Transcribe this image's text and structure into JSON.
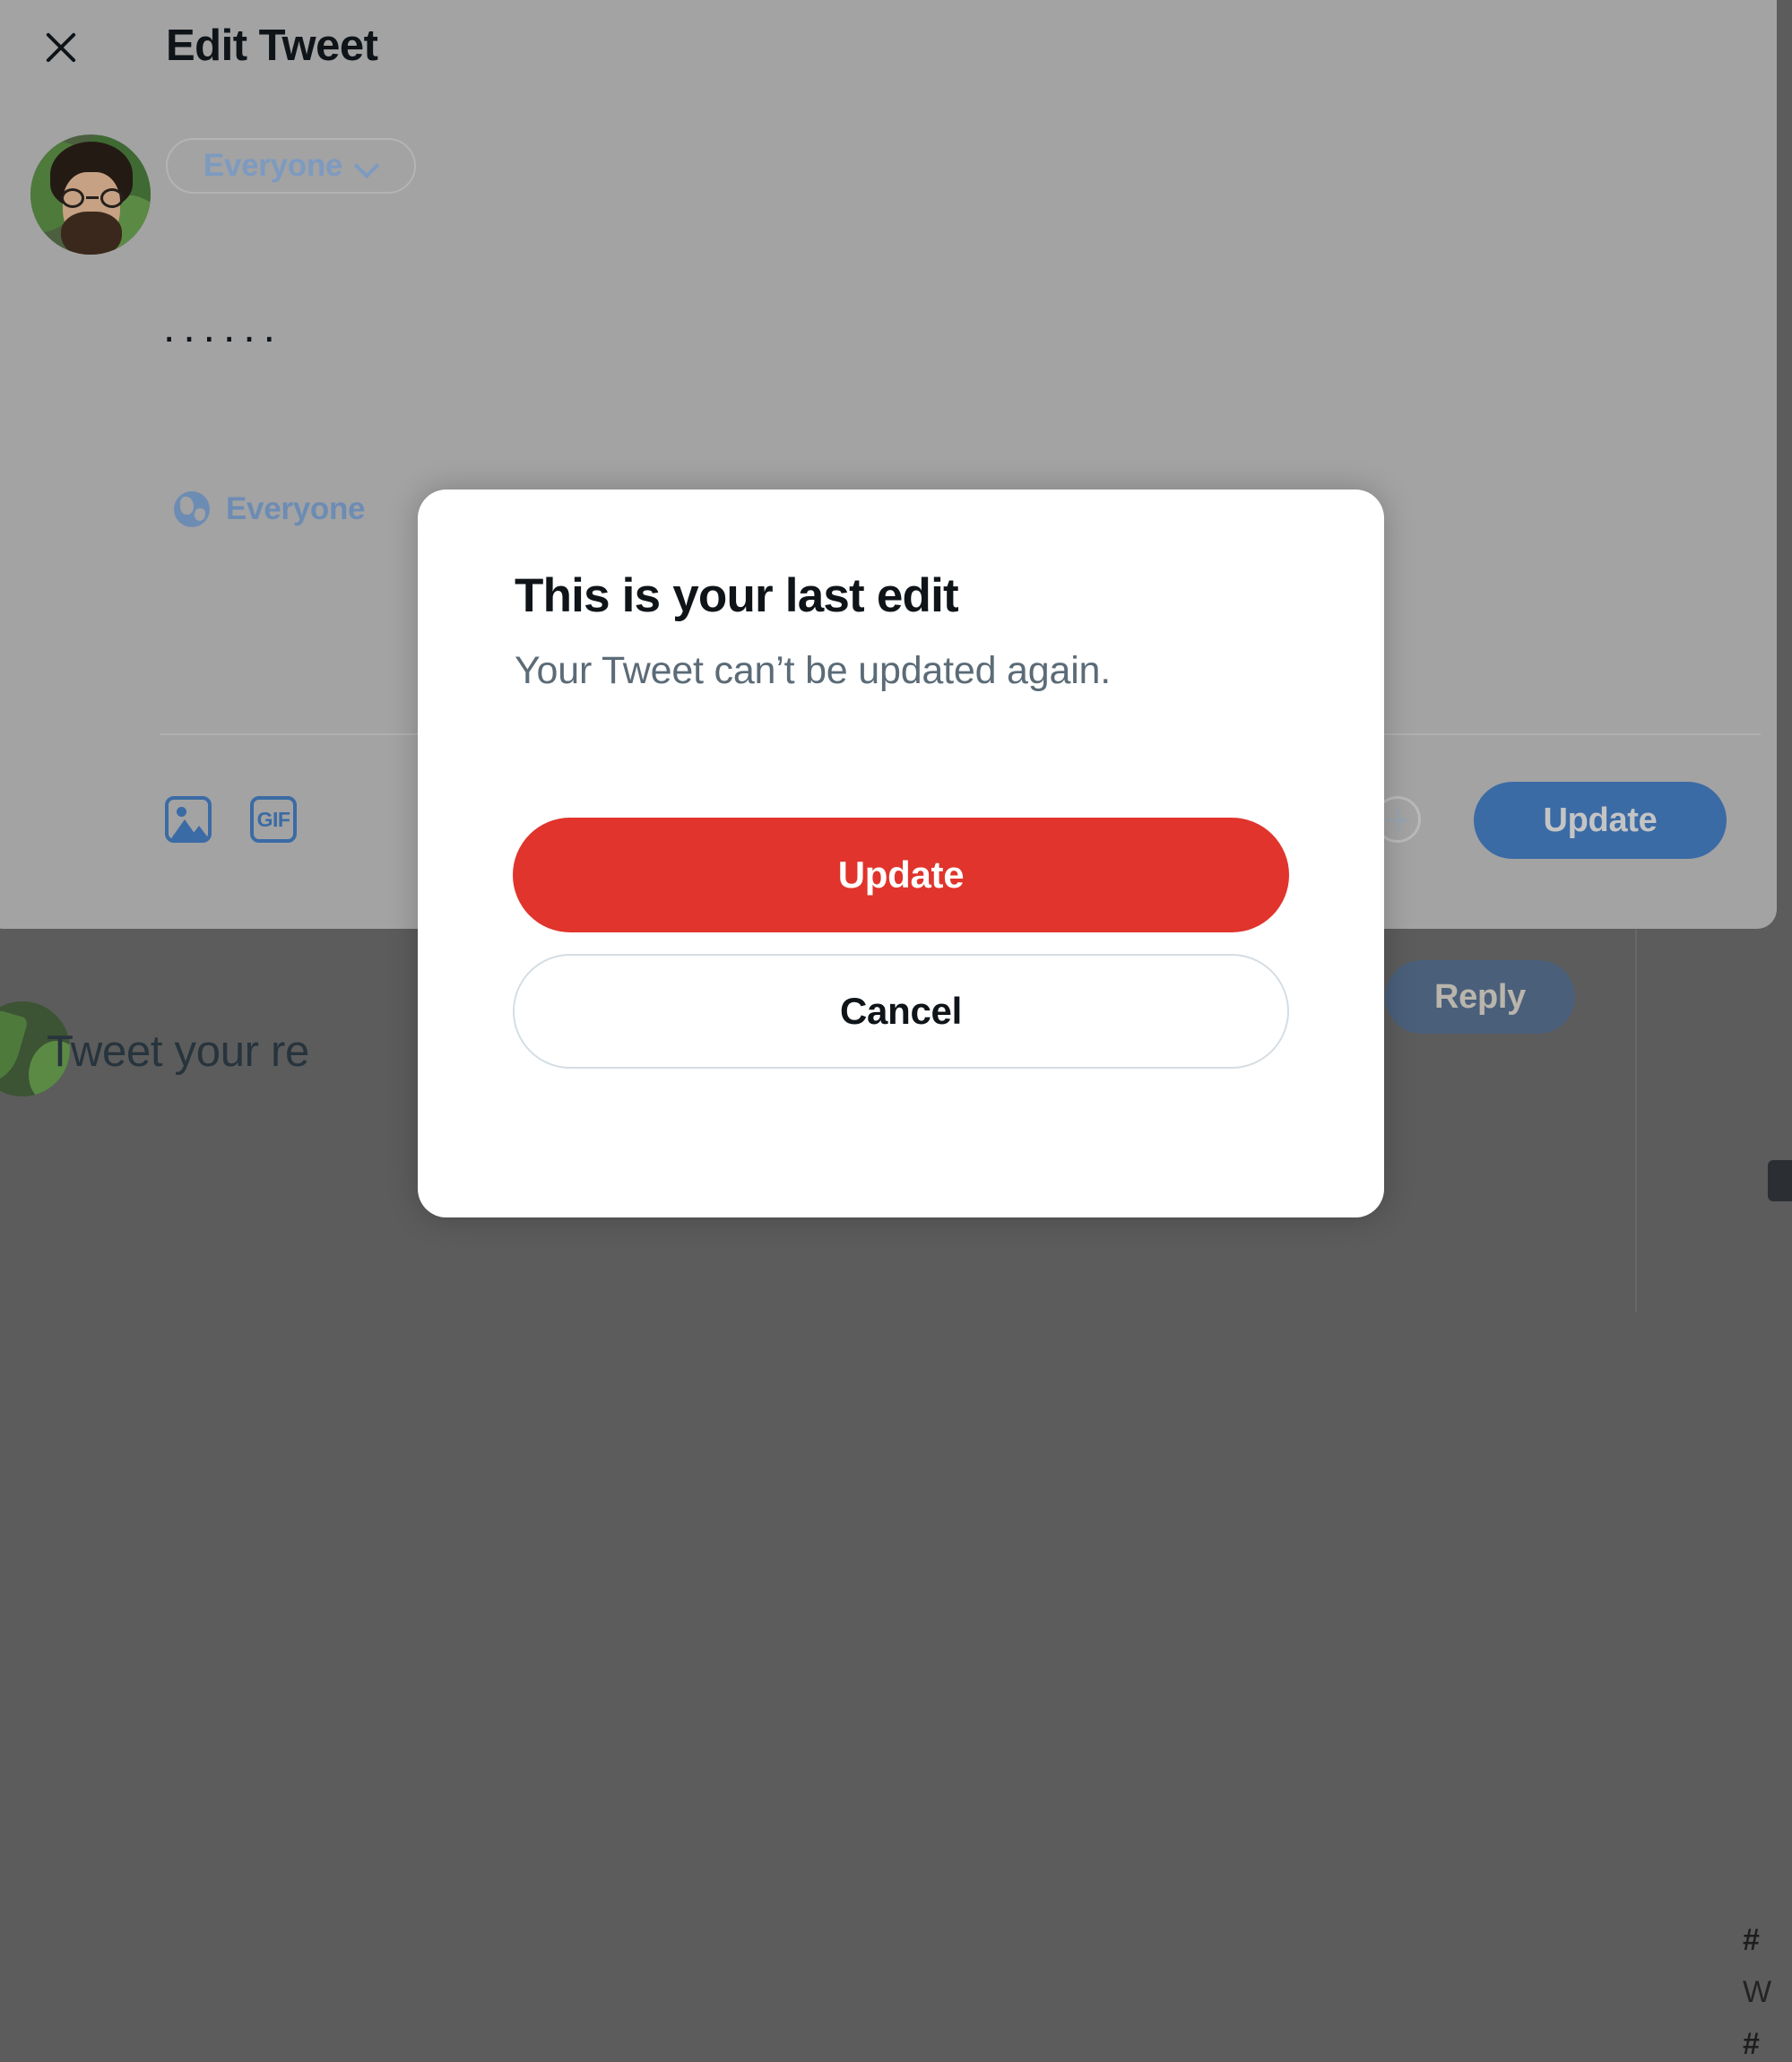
{
  "colors": {
    "danger": "#E0342C",
    "brand_blue": "#1D9BF0",
    "text_primary": "#0F1419",
    "text_secondary": "#5B6B77",
    "scrim": "#5C5C5C"
  },
  "compose_dialog": {
    "title": "Edit Tweet",
    "close_icon": "close-icon",
    "audience": {
      "label": "Everyone",
      "chevron_icon": "chevron-down-icon"
    },
    "tweet_text": "......",
    "reply_audience": {
      "icon": "globe-icon",
      "label": "Everyone"
    },
    "toolbar": {
      "items": [
        {
          "icon": "image-icon",
          "label": ""
        },
        {
          "icon": "gif-icon",
          "label": "GIF"
        }
      ],
      "add_icon": "plus-circle-icon",
      "submit_label": "Update"
    }
  },
  "reply_composer": {
    "placeholder": "Tweet your reply",
    "visible_placeholder": "Tweet your re",
    "submit_label": "Reply",
    "avatar": "avatar"
  },
  "trending_rail": {
    "lines": [
      "#",
      "W",
      "#"
    ]
  },
  "alert_modal": {
    "title": "This is your last edit",
    "message": "Your Tweet can’t be updated again.",
    "confirm_label": "Update",
    "cancel_label": "Cancel"
  }
}
